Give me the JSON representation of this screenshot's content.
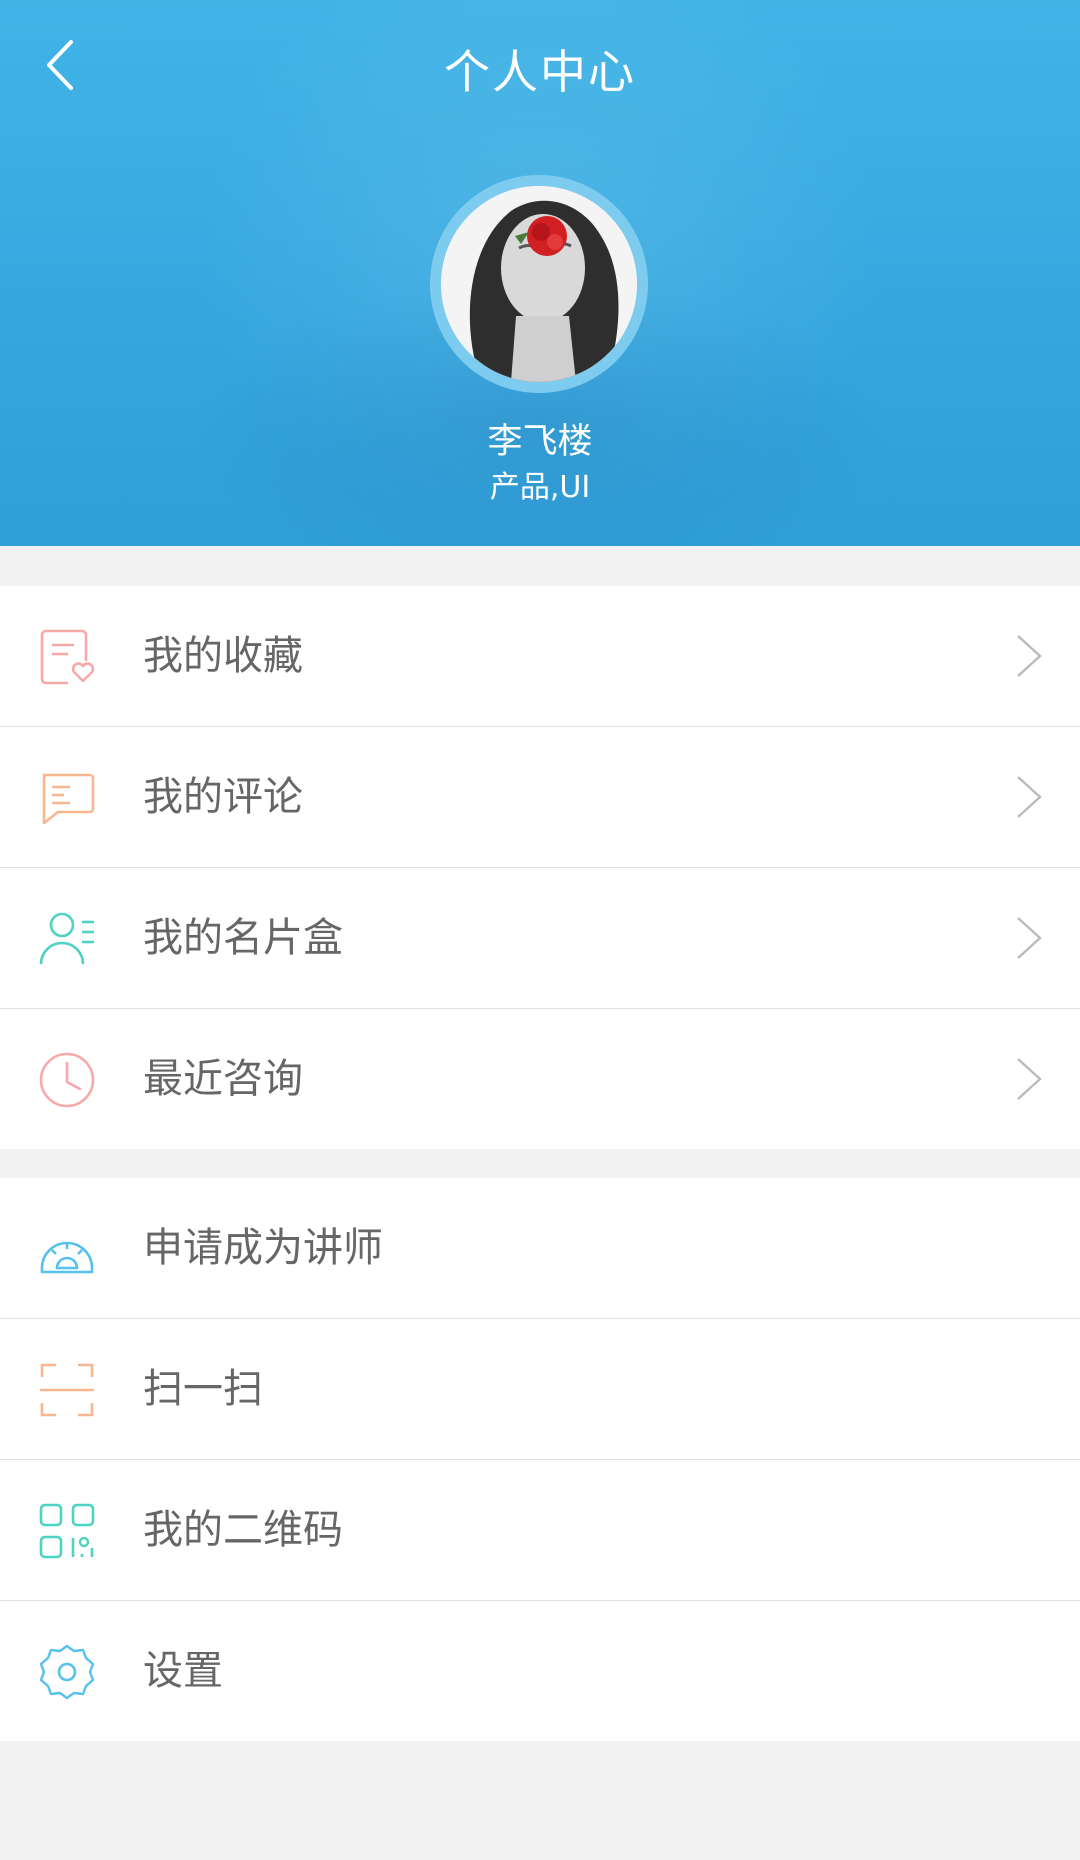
{
  "header": {
    "title": "个人中心",
    "back_icon": "chevron-left-icon",
    "background_color": "#3aaee3"
  },
  "profile": {
    "name": "李飞楼",
    "tags": "产品,UI"
  },
  "menu_group_1": [
    {
      "label": "我的收藏",
      "icon": "favorites-doc-heart-icon",
      "icon_color": "#f7a9a8"
    },
    {
      "label": "我的评论",
      "icon": "comment-bubble-icon",
      "icon_color": "#f7b78f"
    },
    {
      "label": "我的名片盒",
      "icon": "contacts-person-icon",
      "icon_color": "#4fd2c2"
    },
    {
      "label": "最近咨询",
      "icon": "clock-icon",
      "icon_color": "#f7a9a8"
    }
  ],
  "menu_group_2": [
    {
      "label": "申请成为讲师",
      "icon": "lecturer-protractor-icon",
      "icon_color": "#55c1ec"
    },
    {
      "label": "扫一扫",
      "icon": "scan-frame-icon",
      "icon_color": "#f7b78f"
    },
    {
      "label": "我的二维码",
      "icon": "qr-code-icon",
      "icon_color": "#4fd2c2"
    },
    {
      "label": "设置",
      "icon": "gear-icon",
      "icon_color": "#55c1ec"
    }
  ],
  "colors": {
    "chevron": "#bbbbbb",
    "divider": "#e0e0e0",
    "page_background": "#f2f2f2"
  }
}
